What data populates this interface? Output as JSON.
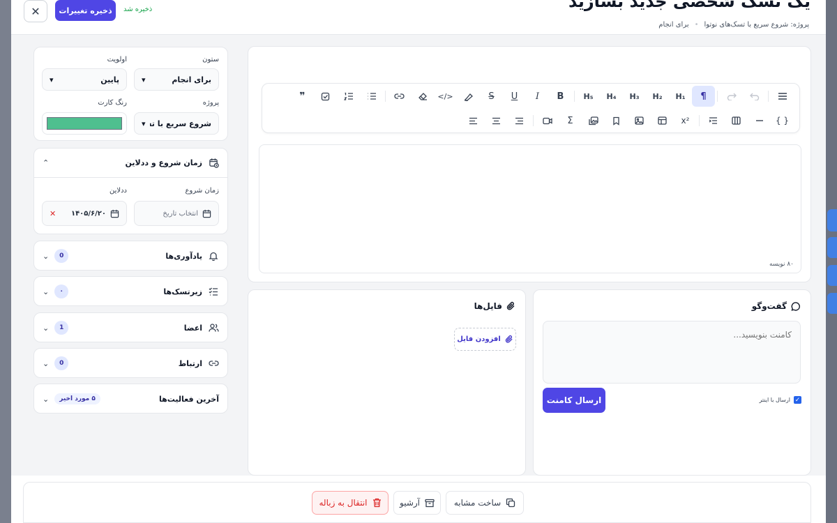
{
  "header": {
    "title": "یک تسک شخصی جدید بسازید",
    "breadcrumb_project": "پروژه: شروع سریع با تسک‌های نوتوا",
    "breadcrumb_column": "برای انجام",
    "save_label": "ذخیره تغییرات",
    "saved_status": "ذخیره شد"
  },
  "sidebar": {
    "column_label": "ستون",
    "column_value": "برای انجام",
    "priority_label": "اولویت",
    "priority_value": "پایین",
    "project_label": "پروژه",
    "project_value": "شروع سریع با تسک‌ه",
    "card_color_label": "رنگ کارت",
    "card_color": "#4fbf8f",
    "schedule": {
      "title": "زمان شروع و ددلاین",
      "start_label": "زمان شروع",
      "start_placeholder": "انتخاب تاریخ",
      "deadline_label": "ددلاین",
      "deadline_value": "۱۴۰۵/۶/۲۰"
    },
    "sections": [
      {
        "title": "یادآوری‌ها",
        "badge": "0"
      },
      {
        "title": "زیرتسک‌ها",
        "badge": "۰"
      },
      {
        "title": "اعضا",
        "badge": "1"
      },
      {
        "title": "ارتباط",
        "badge": "0"
      },
      {
        "title": "آخرین فعالیت‌ها",
        "badge": "۵ مورد اخیر"
      }
    ]
  },
  "editor": {
    "word_count": "۸۰ نویسه",
    "toolbar_row1": [
      "menu",
      "undo",
      "redo",
      "¶",
      "H1",
      "H2",
      "H3",
      "H4",
      "H5",
      "B",
      "I",
      "U",
      "S",
      "highlight",
      "code",
      "eraser",
      "link",
      "bullet-list",
      "ordered-list",
      "task-list",
      "quote"
    ],
    "toolbar_row2": [
      "{ }",
      "hr",
      "columns",
      "indent-list",
      "x²",
      "table",
      "image",
      "bookmark",
      "gallery",
      "Σ",
      "video",
      "align-right",
      "align-center",
      "align-left"
    ]
  },
  "comments": {
    "title": "گفت‌وگو",
    "placeholder": "کامنت بنویسید...",
    "send_label": "ارسال کامنت",
    "send_on_enter_label": "ارسال با اینتر"
  },
  "files": {
    "title": "فایل‌ها",
    "add_label": "افزودن فایل"
  },
  "footer": {
    "duplicate_label": "ساخت مشابه",
    "archive_label": "آرشیو",
    "trash_label": "انتقال به زباله"
  },
  "colors": {
    "accent": "#4f46e5",
    "saved_green": "#16a34a",
    "danger": "#dc2626"
  }
}
